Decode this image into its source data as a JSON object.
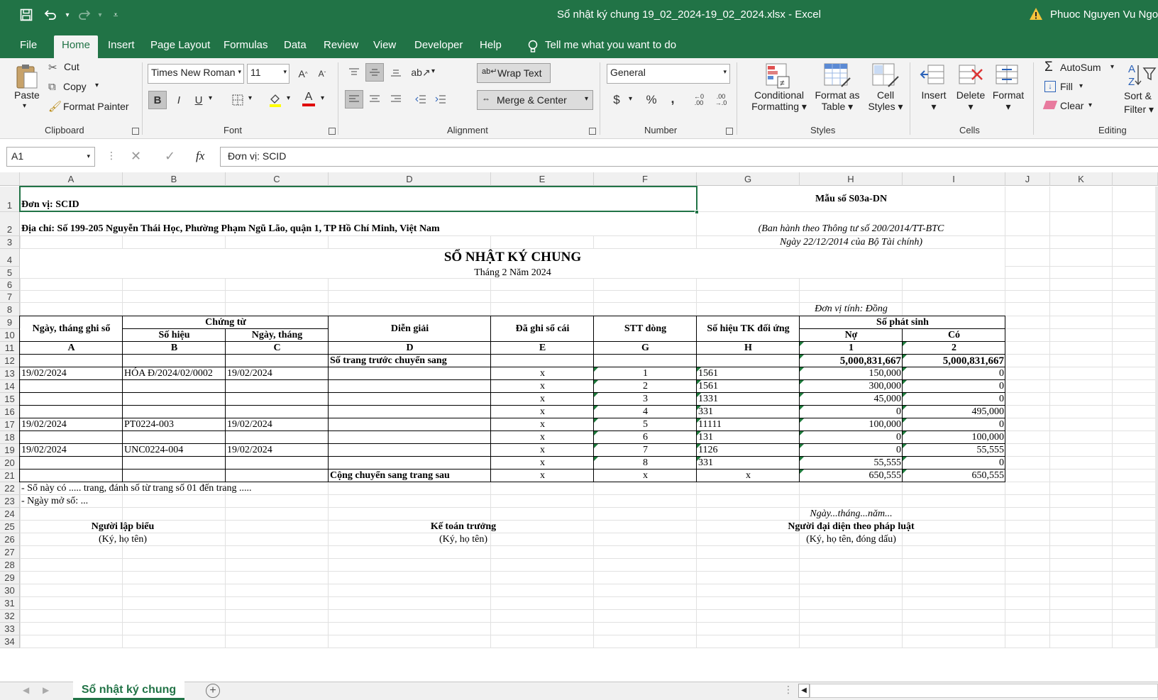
{
  "app": {
    "window_title": "Sổ nhật ký chung 19_02_2024-19_02_2024.xlsx  -  Excel",
    "user": "Phuoc Nguyen Vu Ngoc",
    "accent": "#217346"
  },
  "quick_access": [
    "save-icon",
    "undo-icon",
    "redo-icon",
    "customize-icon"
  ],
  "ribbon_tabs": [
    "File",
    "Home",
    "Insert",
    "Page Layout",
    "Formulas",
    "Data",
    "Review",
    "View",
    "Developer",
    "Help"
  ],
  "tell_me": "Tell me what you want to do",
  "clipboard": {
    "paste": "Paste",
    "cut": "Cut",
    "copy": "Copy",
    "format_painter": "Format Painter",
    "label": "Clipboard"
  },
  "font": {
    "name": "Times New Roman",
    "size": "11",
    "label": "Font",
    "bold": "B",
    "italic": "I",
    "underline": "U",
    "font_color": "A",
    "grow": "A",
    "shrink": "A"
  },
  "alignment": {
    "wrap": "Wrap Text",
    "merge": "Merge & Center",
    "label": "Alignment"
  },
  "number": {
    "format": "General",
    "currency": "$",
    "percent": "%",
    "comma": ",",
    "label": "Number"
  },
  "styles": {
    "conditional": "Conditional",
    "conditional2": "Formatting",
    "format_table": "Format as",
    "format_table2": "Table",
    "cell_styles": "Cell",
    "cell_styles2": "Styles",
    "label": "Styles"
  },
  "cells": {
    "insert": "Insert",
    "delete": "Delete",
    "format": "Format",
    "label": "Cells"
  },
  "editing": {
    "autosum": "AutoSum",
    "fill": "Fill",
    "clear": "Clear",
    "sort": "Sort &",
    "filter": "Filter",
    "label": "Editing"
  },
  "formula_bar": {
    "name_box": "A1",
    "fx": "fx",
    "content": "Đơn vị: SCID"
  },
  "columns": [
    "A",
    "B",
    "C",
    "D",
    "E",
    "F",
    "G",
    "H",
    "I",
    "J",
    "K"
  ],
  "rows": [
    "1",
    "2",
    "3",
    "4",
    "5",
    "6",
    "7",
    "8",
    "9",
    "10",
    "11",
    "12",
    "13",
    "14",
    "15",
    "16",
    "17",
    "18",
    "19",
    "20",
    "21",
    "22",
    "23",
    "24",
    "25",
    "26",
    "27",
    "28",
    "29",
    "30",
    "31",
    "32",
    "33",
    "34"
  ],
  "sheet": {
    "unit": "Đơn vị: SCID",
    "address": "Địa chỉ: Số 199-205 Nguyễn Thái Học, Phường Phạm Ngũ Lão, quận 1, TP Hồ Chí Minh, Việt Nam",
    "form_no": "Mẫu số S03a-DN",
    "issued": "(Ban hành theo Thông tư số 200/2014/TT-BTC",
    "issued_date": "Ngày 22/12/2014 của Bộ Tài chính)",
    "title": "SỔ NHẬT KÝ CHUNG",
    "period": "Tháng 2 Năm 2024",
    "currency_unit": "Đơn vị tính: Đồng",
    "headers": {
      "date": "Ngày, tháng ghi sổ",
      "voucher": "Chứng từ",
      "voucher_no": "Số hiệu",
      "voucher_date": "Ngày, tháng",
      "desc": "Diễn giải",
      "posted": "Đã ghi sổ cái",
      "line": "STT dòng",
      "account": "Số hiệu TK đối ứng",
      "amount": "Số phát sinh",
      "debit": "Nợ",
      "credit": "Có"
    },
    "letters": [
      "A",
      "B",
      "C",
      "D",
      "E",
      "G",
      "H",
      "1",
      "2"
    ],
    "carry_in": {
      "label": "Số trang trước chuyển sang",
      "debit": "5,000,831,667",
      "credit": "5,000,831,667"
    },
    "entries": [
      {
        "date": "19/02/2024",
        "no": "HÓA Đ/2024/02/0002",
        "vdate": "19/02/2024",
        "posted": "x",
        "line": "1",
        "acct": "1561",
        "debit": "150,000",
        "credit": "0"
      },
      {
        "date": "",
        "no": "",
        "vdate": "",
        "posted": "x",
        "line": "2",
        "acct": "1561",
        "debit": "300,000",
        "credit": "0"
      },
      {
        "date": "",
        "no": "",
        "vdate": "",
        "posted": "x",
        "line": "3",
        "acct": "1331",
        "debit": "45,000",
        "credit": "0"
      },
      {
        "date": "",
        "no": "",
        "vdate": "",
        "posted": "x",
        "line": "4",
        "acct": "331",
        "debit": "0",
        "credit": "495,000"
      },
      {
        "date": "19/02/2024",
        "no": "PT0224-003",
        "vdate": "19/02/2024",
        "posted": "x",
        "line": "5",
        "acct": "11111",
        "debit": "100,000",
        "credit": "0"
      },
      {
        "date": "",
        "no": "",
        "vdate": "",
        "posted": "x",
        "line": "6",
        "acct": "131",
        "debit": "0",
        "credit": "100,000"
      },
      {
        "date": "19/02/2024",
        "no": "UNC0224-004",
        "vdate": "19/02/2024",
        "posted": "x",
        "line": "7",
        "acct": "1126",
        "debit": "0",
        "credit": "55,555"
      },
      {
        "date": "",
        "no": "",
        "vdate": "",
        "posted": "x",
        "line": "8",
        "acct": "331",
        "debit": "55,555",
        "credit": "0"
      }
    ],
    "carry_out": {
      "label": "Cộng chuyển sang trang sau",
      "posted": "x",
      "line": "x",
      "acct": "x",
      "debit": "650,555",
      "credit": "650,555"
    },
    "note1": "- Sổ này có ..... trang, đánh số từ trang số 01 đến trang .....",
    "note2": "- Ngày mở sổ: ...",
    "date_line": "Ngày...tháng...năm...",
    "sig1": "Người lập biểu",
    "sig1s": "(Ký, họ tên)",
    "sig2": "Kế toán trưởng",
    "sig2s": "(Ký, họ tên)",
    "sig3": "Người đại diện theo pháp luật",
    "sig3s": "(Ký, họ tên, đóng dấu)"
  },
  "sheet_tab": "Sổ nhật ký chung"
}
